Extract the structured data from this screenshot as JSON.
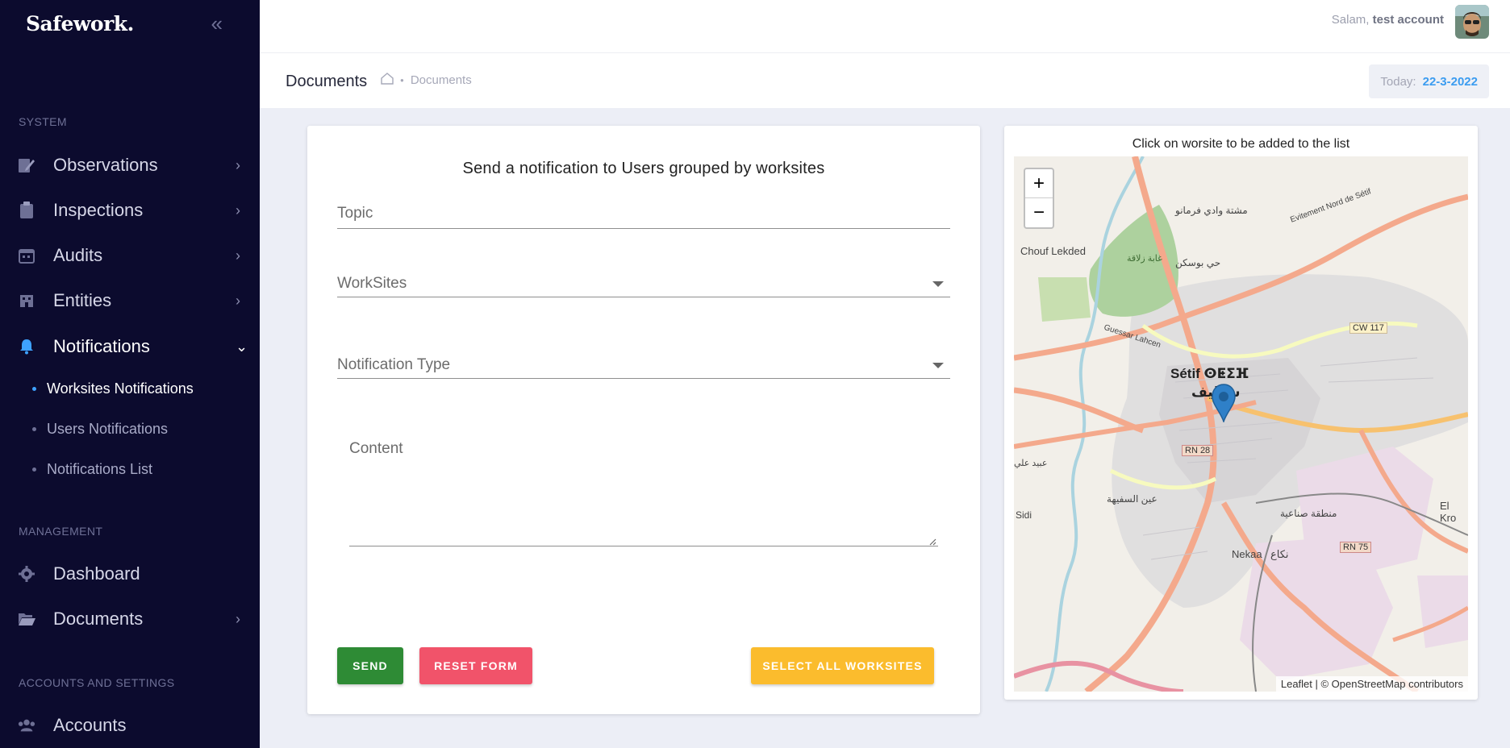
{
  "app": {
    "brand": "Safework."
  },
  "sidebar": {
    "sections": {
      "system": "SYSTEM",
      "management": "MANAGEMENT",
      "accounts": "ACCOUNTS AND SETTINGS"
    },
    "items": {
      "observations": "Observations",
      "inspections": "Inspections",
      "audits": "Audits",
      "entities": "Entities",
      "notifications": "Notifications",
      "dashboard": "Dashboard",
      "documents": "Documents",
      "accounts": "Accounts"
    },
    "notifications_sub": {
      "worksites": "Worksites Notifications",
      "users": "Users Notifications",
      "list": "Notifications List"
    },
    "accent_color": "#3ea2ff"
  },
  "topbar": {
    "greeting": "Salam,",
    "username": "test account"
  },
  "subheader": {
    "title": "Documents",
    "breadcrumb_current": "Documents",
    "today_label": "Today:",
    "today_value": "22-3-2022"
  },
  "form": {
    "heading": "Send a notification to Users grouped by worksites",
    "topic_label": "Topic",
    "worksites_label": "WorkSites",
    "type_label": "Notification Type",
    "content_label": "Content",
    "send_label": "SEND",
    "reset_label": "RESET FORM",
    "select_all_label": "SELECT ALL WORKSITES",
    "colors": {
      "send": "#2e8b35",
      "reset": "#f1536a",
      "select_all": "#fbbc2d"
    }
  },
  "map": {
    "title": "Click on worsite to be added to the list",
    "zoom_in": "+",
    "zoom_out": "−",
    "attribution": "Leaflet | © OpenStreetMap contributors",
    "labels": {
      "city_latin": "Sétif ⵙⵟⵉⴼ",
      "city_arabic": "سطيف",
      "chouf": "Chouf Lekded",
      "rn28": "RN 28",
      "rn75": "RN 75",
      "cw117": "CW 117",
      "nekaa_latin": "Nekaa",
      "nekaa_arabic": "نكاع",
      "el_kr": "El Kro",
      "sidi": "Sidi",
      "evitement": "Evitement Nord de Sétif",
      "ain": "عين السفيهة",
      "zone": "منطقة صناعية",
      "mechta": "مشتة وادي فرمانو",
      "hay": "حي بوسكن",
      "ghabat": "غابة زلاقة",
      "obeid": "عبيد علي",
      "guessar": "Guessar Lahcen"
    }
  }
}
